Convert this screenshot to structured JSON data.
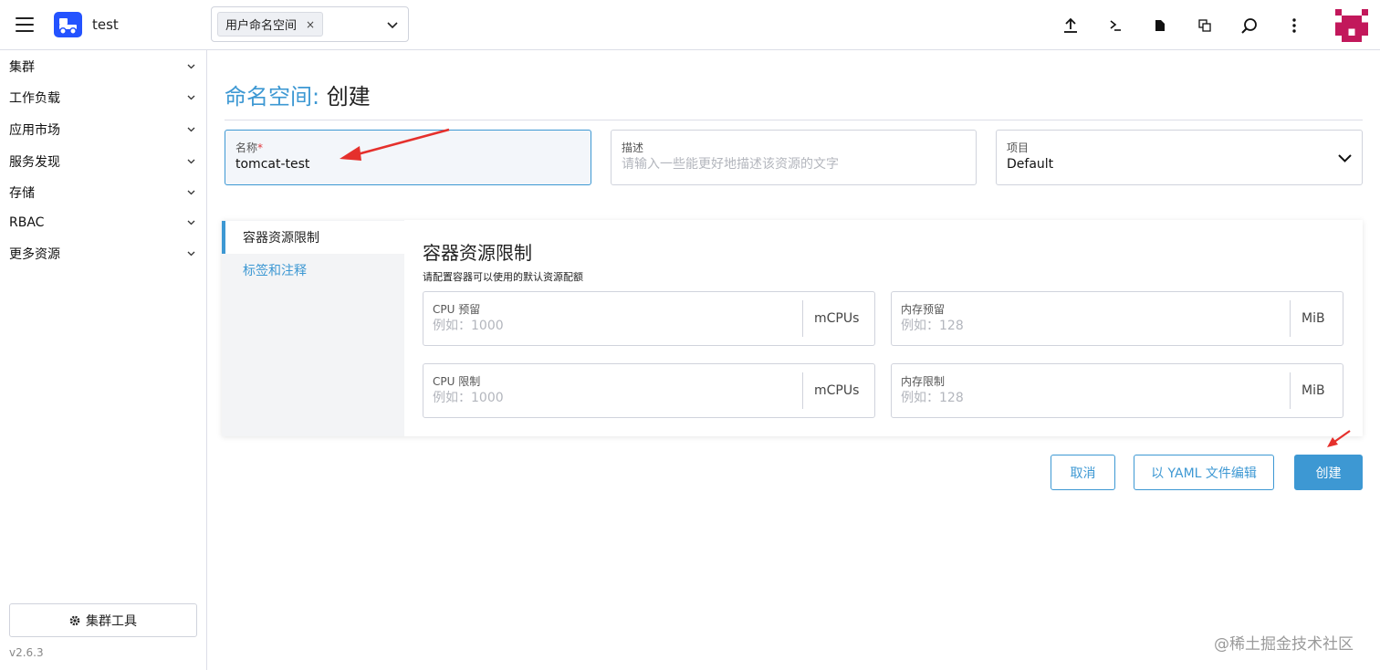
{
  "header": {
    "cluster_name": "test",
    "namespace_chip": "用户命名空间",
    "chip_remove": "×",
    "icons": [
      "upload-icon",
      "terminal-icon",
      "file-icon",
      "copy-icon",
      "search-icon",
      "more-vert-icon"
    ]
  },
  "sidebar": {
    "items": [
      {
        "label": "集群"
      },
      {
        "label": "工作负载"
      },
      {
        "label": "应用市场"
      },
      {
        "label": "服务发现"
      },
      {
        "label": "存储"
      },
      {
        "label": "RBAC"
      },
      {
        "label": "更多资源"
      }
    ],
    "tools_button": "集群工具",
    "version": "v2.6.3"
  },
  "page": {
    "title_type": "命名空间:",
    "title_action": "创建",
    "name_label": "名称",
    "name_required": "*",
    "name_value": "tomcat-test",
    "desc_label": "描述",
    "desc_placeholder": "请输入一些能更好地描述该资源的文字",
    "project_label": "项目",
    "project_value": "Default"
  },
  "tabs": [
    {
      "label": "容器资源限制",
      "active": true
    },
    {
      "label": "标签和注释",
      "active": false
    }
  ],
  "section": {
    "title": "容器资源限制",
    "subtitle": "请配置容器可以使用的默认资源配额",
    "fields": [
      {
        "label": "CPU 预留",
        "placeholder": "例如：1000",
        "unit": "mCPUs"
      },
      {
        "label": "内存预留",
        "placeholder": "例如：128",
        "unit": "MiB"
      },
      {
        "label": "CPU 限制",
        "placeholder": "例如：1000",
        "unit": "mCPUs"
      },
      {
        "label": "内存限制",
        "placeholder": "例如：128",
        "unit": "MiB"
      }
    ]
  },
  "buttons": {
    "cancel": "取消",
    "edit_yaml": "以 YAML 文件编辑",
    "create": "创建"
  },
  "watermark": "@稀土掘金技术社区",
  "colors": {
    "accent": "#3d98d3",
    "annotation_arrow": "#e5302c",
    "logo": "#2453ff",
    "avatar": "#c2185b"
  }
}
